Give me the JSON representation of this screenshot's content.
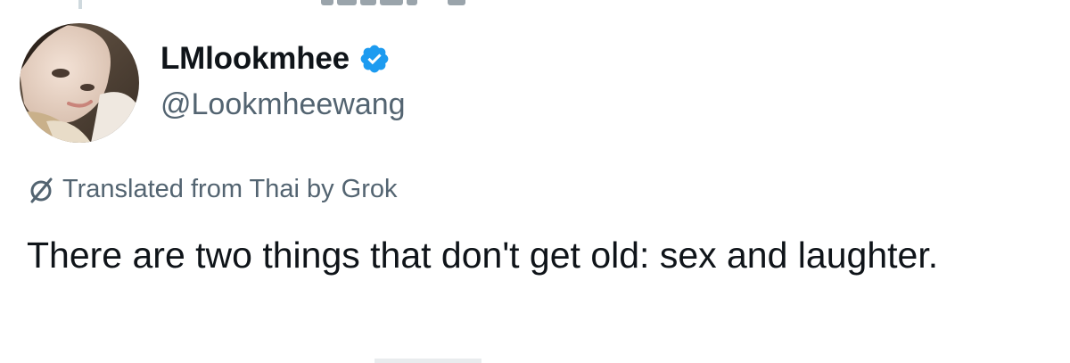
{
  "tweet": {
    "author": {
      "display_name": "LMlookmhee",
      "handle": "@Lookmheewang",
      "verified": true,
      "avatar": "profile-photo"
    },
    "translation_note": "Translated from Thai by Grok",
    "text": "There are two things that don't get old: sex and laughter."
  },
  "icons": {
    "verified": "verified-badge-icon",
    "translate": "grok-icon"
  },
  "colors": {
    "primary_text": "#0f1419",
    "secondary_text": "#536471",
    "verified_blue": "#1d9bf0",
    "background": "#ffffff"
  }
}
